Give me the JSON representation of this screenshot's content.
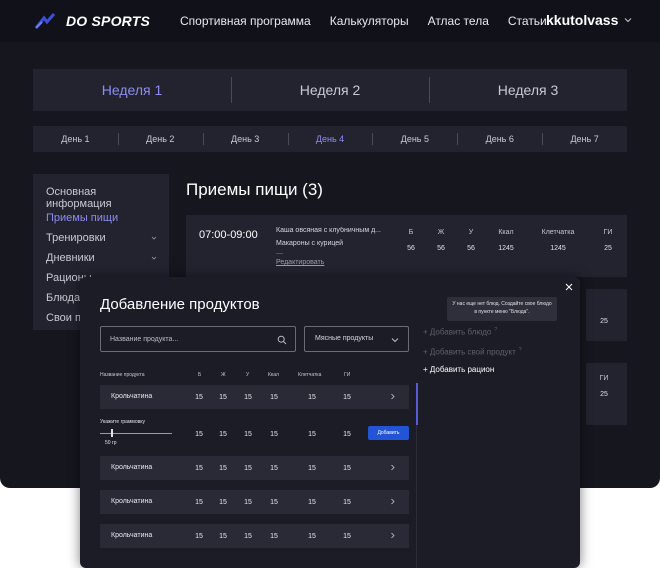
{
  "header": {
    "logo_text": "DO SPORTS",
    "nav": [
      "Спортивная программа",
      "Калькуляторы",
      "Атлас тела",
      "Статьи"
    ],
    "user_name": "kkutolvass"
  },
  "weeks": [
    "Неделя 1",
    "Неделя 2",
    "Неделя 3"
  ],
  "active_week": 0,
  "days": [
    "День 1",
    "День 2",
    "День 3",
    "День 4",
    "День 5",
    "День 6",
    "День 7"
  ],
  "active_day": 3,
  "sidebar": {
    "items": [
      {
        "label": "Основная информация",
        "has_chevron": false
      },
      {
        "label": "Приемы пищи",
        "has_chevron": false
      },
      {
        "label": "Тренировки",
        "has_chevron": true
      },
      {
        "label": "Дневники",
        "has_chevron": true
      },
      {
        "label": "Рационы",
        "has_chevron": false
      },
      {
        "label": "Блюда",
        "has_chevron": false
      },
      {
        "label": "Свои пр",
        "has_chevron": false
      }
    ]
  },
  "meals": {
    "title": "Приемы пищи (3)",
    "headers": [
      "Б",
      "Ж",
      "У",
      "Ккал",
      "Клетчатка",
      "ГИ"
    ],
    "card": {
      "time": "07:00-09:00",
      "food1": "Каша овсяная с клубничным д...",
      "food2": "Макароны с курицей",
      "dash": "—",
      "edit": "Редактировать",
      "values": [
        "56",
        "56",
        "56",
        "1245",
        "1245",
        "25"
      ]
    },
    "side_cards": [
      {
        "value": "25"
      },
      {
        "header": "ГИ",
        "value": "25"
      }
    ]
  },
  "modal": {
    "title": "Добавление продуктов",
    "search_placeholder": "Название продукта...",
    "category": "Мясные продукты",
    "columns": [
      "Название продукта",
      "Б",
      "Ж",
      "У",
      "Ккал",
      "Клетчатка",
      "ГИ"
    ],
    "rows": [
      {
        "name": "Крольчатина",
        "values": [
          "15",
          "15",
          "15",
          "15",
          "15",
          "15"
        ]
      },
      {
        "name": "Крольчатина",
        "values": [
          "15",
          "15",
          "15",
          "15",
          "15",
          "15"
        ]
      },
      {
        "name": "Крольчатина",
        "values": [
          "15",
          "15",
          "15",
          "15",
          "15",
          "15"
        ]
      },
      {
        "name": "Крольчатина",
        "values": [
          "15",
          "15",
          "15",
          "15",
          "15",
          "15"
        ]
      }
    ],
    "expanded": {
      "label": "Укажите граммовку",
      "grams": "50 гр",
      "values": [
        "15",
        "15",
        "15",
        "15",
        "15",
        "15"
      ],
      "add_label": "Добавить"
    },
    "tooltip": "У нас еще нет блюд. Создайте свое блюдо в пункте меню \"Блюда\".",
    "links": [
      {
        "label": "+ Добавить блюдо",
        "sup": "?",
        "active": false
      },
      {
        "label": "+ Добавить свой продукт",
        "sup": "?",
        "active": false
      },
      {
        "label": "+ Добавить рацион",
        "sup": "",
        "active": true
      }
    ]
  },
  "colors": {
    "accent": "#8c8cf0",
    "button": "#2454d6",
    "background": "#16161f",
    "card": "#232330"
  }
}
